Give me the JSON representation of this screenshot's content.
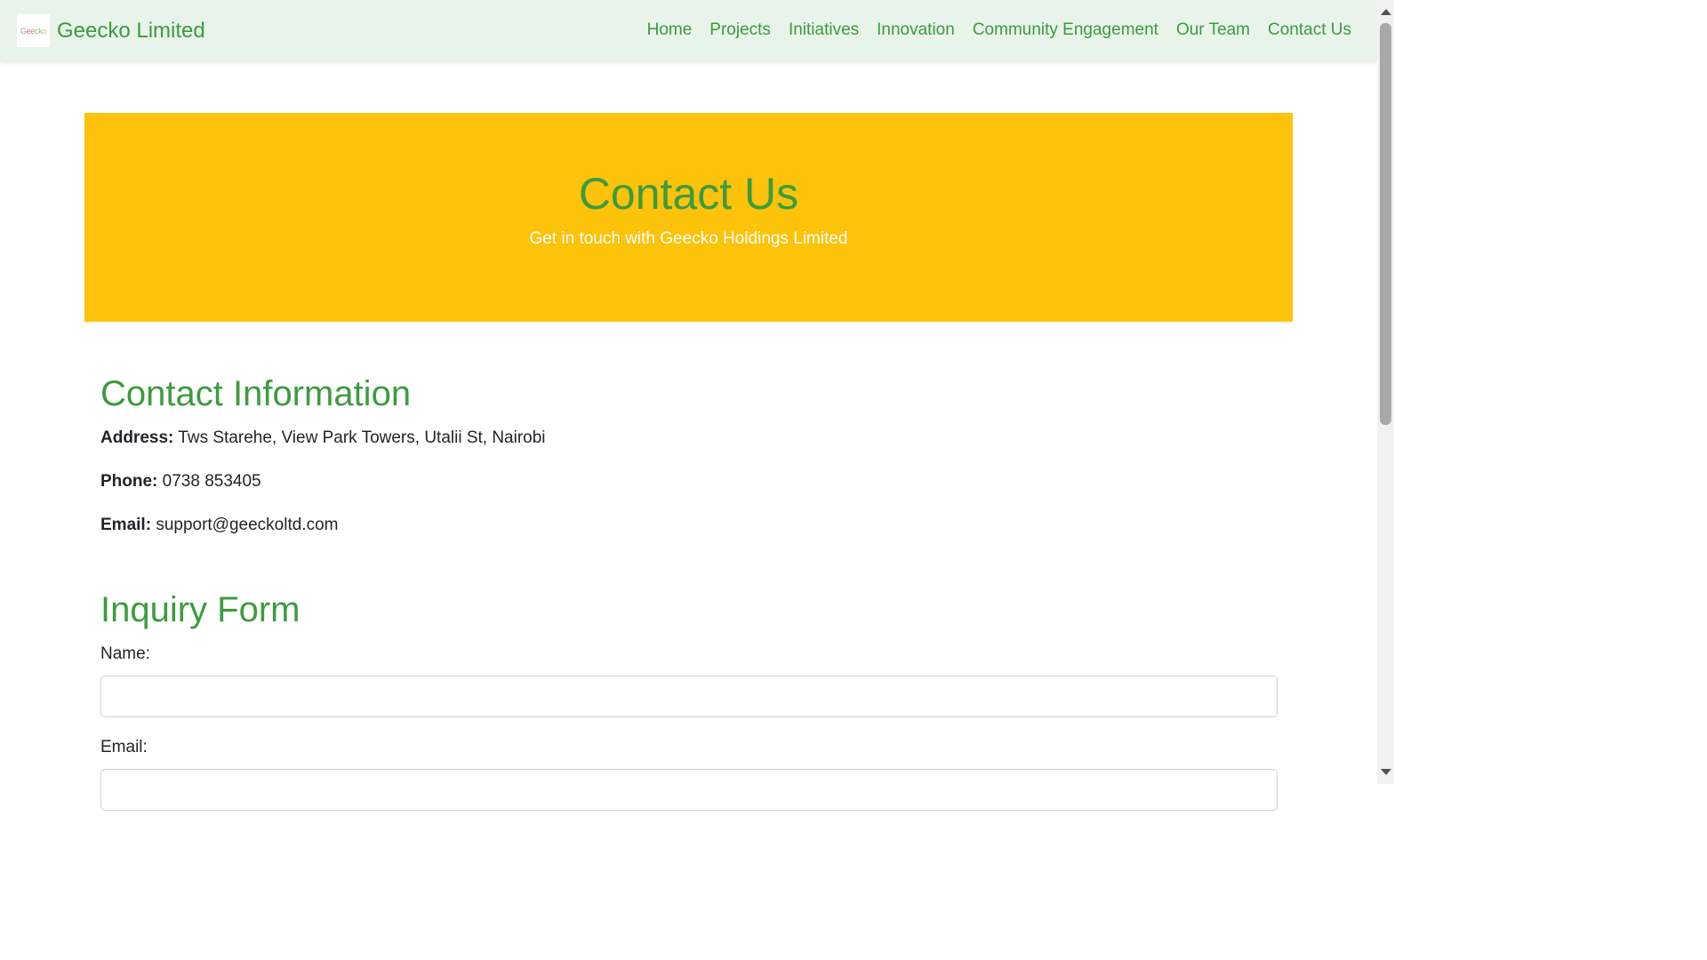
{
  "navbar": {
    "brand": "Geecko Limited",
    "logo_text": [
      "G",
      "ee",
      "ck",
      "o"
    ],
    "items": [
      "Home",
      "Projects",
      "Initiatives",
      "Innovation",
      "Community Engagement",
      "Our Team",
      "Contact Us"
    ]
  },
  "hero": {
    "title": "Contact Us",
    "subtitle": "Get in touch with Geecko Holdings Limited"
  },
  "contact_info": {
    "heading": "Contact Information",
    "address_label": "Address:",
    "address_value": "Tws Starehe, View Park Towers, Utalii St, Nairobi",
    "phone_label": "Phone:",
    "phone_value": "0738 853405",
    "email_label": "Email:",
    "email_value": "support@geeckoltd.com"
  },
  "inquiry_form": {
    "heading": "Inquiry Form",
    "name_label": "Name:",
    "name_value": "",
    "email_label": "Email:",
    "email_value": ""
  },
  "colors": {
    "brand_green": "#3d9b3f",
    "hero_yellow": "#fdc20a",
    "navbar_bg": "#e8f3ea"
  }
}
